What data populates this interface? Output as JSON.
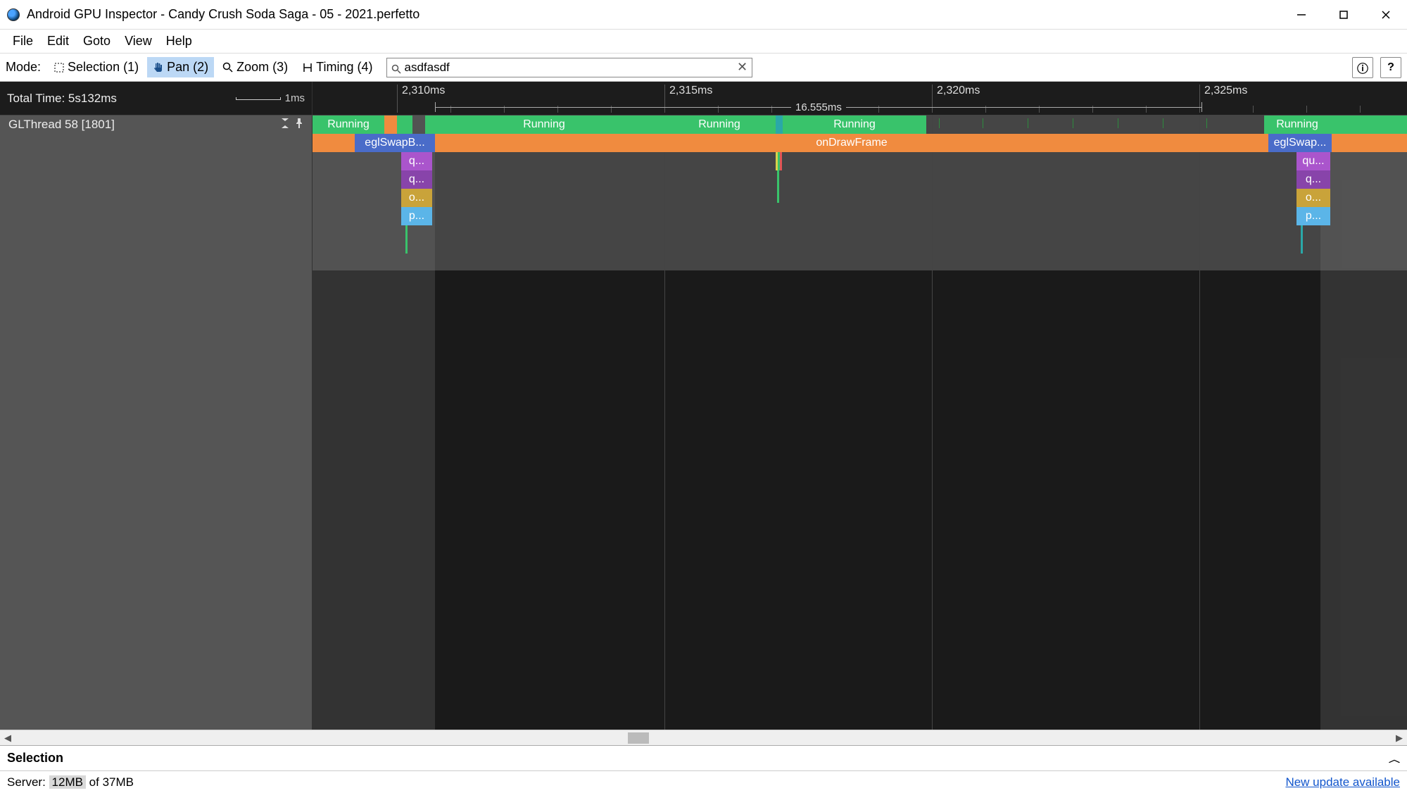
{
  "window": {
    "title": "Android GPU Inspector - Candy Crush Soda Saga - 05 - 2021.perfetto"
  },
  "menu": {
    "file": "File",
    "edit": "Edit",
    "goto": "Goto",
    "view": "View",
    "help": "Help"
  },
  "toolbar": {
    "mode_label": "Mode:",
    "selection": "Selection (1)",
    "pan": "Pan (2)",
    "zoom": "Zoom (3)",
    "timing": "Timing (4)",
    "search_value": "asdfasdf"
  },
  "timeline": {
    "total_time_label": "Total Time: 5s132ms",
    "scale_label": "1ms",
    "ticks": [
      "2,310ms",
      "2,315ms",
      "2,320ms",
      "2,325ms"
    ],
    "range_label": "16.555ms",
    "track_name": "GLThread 58 [1801]",
    "segs": {
      "running": "Running",
      "eglswap": "eglSwapB...",
      "eglswap2": "eglSwap...",
      "ondraw": "onDrawFrame",
      "q": "q...",
      "qu": "qu...",
      "o": "o...",
      "p": "p..."
    }
  },
  "selection": {
    "title": "Selection"
  },
  "status": {
    "server_prefix": "Server: ",
    "server_used": "12MB",
    "server_suffix": " of 37MB",
    "update": "New update available"
  }
}
